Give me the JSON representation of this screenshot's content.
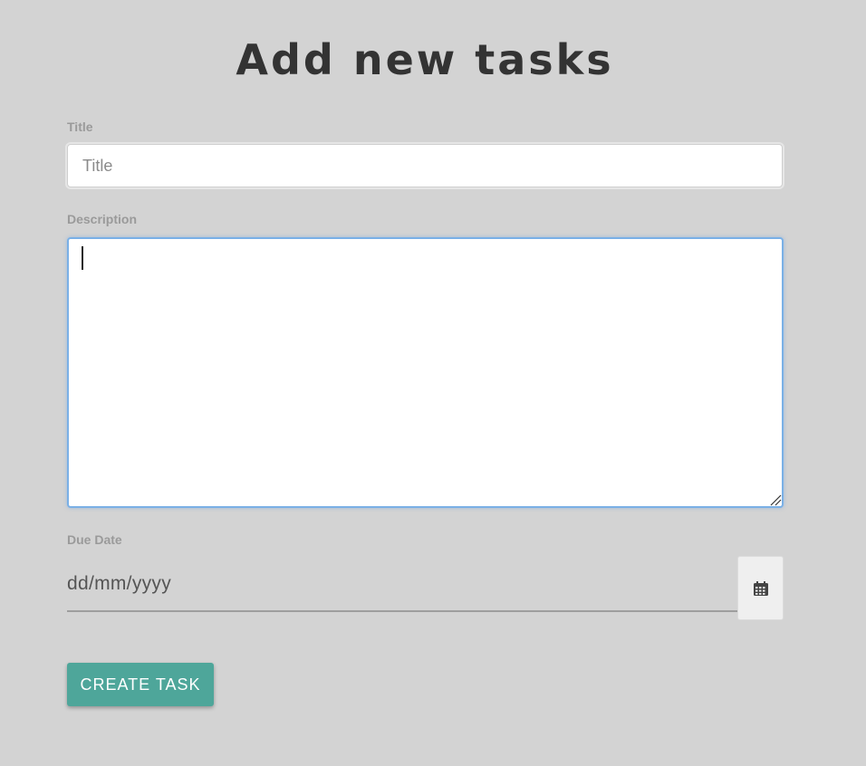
{
  "page": {
    "title": "Add new tasks"
  },
  "form": {
    "title_field": {
      "label": "Title",
      "placeholder": "Title",
      "value": ""
    },
    "description_field": {
      "label": "Description",
      "value": ""
    },
    "due_date_field": {
      "label": "Due Date",
      "placeholder": "dd/mm/yyyy",
      "icon": "calendar-icon"
    },
    "submit": {
      "label": "CREATE TASK"
    }
  },
  "colors": {
    "background": "#d3d3d3",
    "primary_button": "#4ea69a",
    "focus_border": "#7ab0e6",
    "title_text": "#333333"
  }
}
